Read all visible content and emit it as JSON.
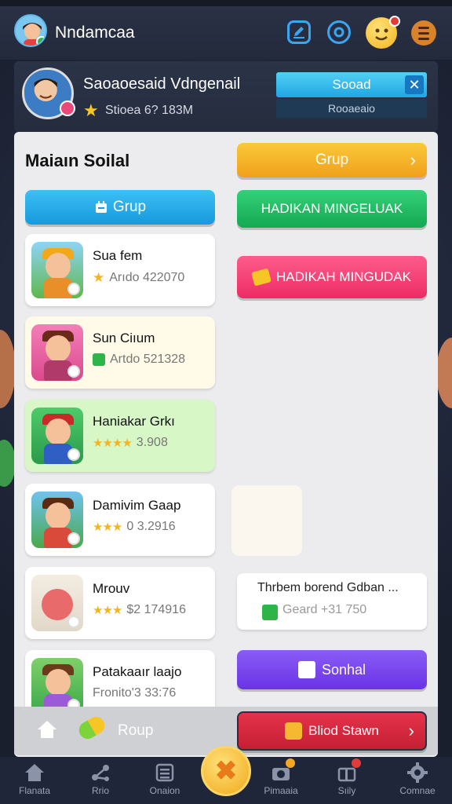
{
  "header": {
    "title": "Nndamcaa",
    "icons": [
      "edit-icon",
      "support-icon",
      "emoji-icon",
      "menu-icon"
    ]
  },
  "profile": {
    "name": "Saoaoesaid Vdngenail",
    "sub": "Stioea 6? 183M",
    "primary_button": "Sooad",
    "close": "✕",
    "secondary_button": "Rooaeaio"
  },
  "panel": {
    "title": "Maiaın Soilal",
    "btn_grup_top": "Gruр",
    "btn_grup_blue": "Grup",
    "btn_green": "HADIKAN MINGELUAK",
    "btn_pink": "HADIKAH MINGUDAK",
    "cards": [
      {
        "name": "Sua fem",
        "meta": "Arıdo 422070"
      },
      {
        "name": "Sun Ciıum",
        "meta": "Artdo 521328"
      },
      {
        "name": "Haniakar Grkı",
        "meta": "3.908"
      },
      {
        "name": "Damivim Gaap",
        "meta": "0 3.2916"
      },
      {
        "name": "Mrouv",
        "meta": "$2 174916"
      },
      {
        "name": "Patakaaır laajo",
        "meta": "Fronito'3 33:76"
      }
    ],
    "right_card": {
      "title": "Thrbem borend Gdban ...",
      "meta": "Geard +31 750"
    },
    "btn_purple": "Sonhal",
    "strip_label": "Roup",
    "btn_red": "Bliod Stawn"
  },
  "bottom_nav": [
    {
      "label": "Flanata",
      "icon": "home-icon"
    },
    {
      "label": "Rrio",
      "icon": "share-icon"
    },
    {
      "label": "Onaion",
      "icon": "list-icon"
    },
    {
      "label": "",
      "icon": "center-star-icon"
    },
    {
      "label": "Pimaaia",
      "icon": "camera-icon"
    },
    {
      "label": "Sıily",
      "icon": "gift-box-icon"
    },
    {
      "label": "Comnae",
      "icon": "gear-icon"
    }
  ],
  "colors": {
    "accent_blue": "#1fa6e3",
    "accent_yellow": "#f0a01b",
    "accent_green": "#14a852",
    "accent_pink": "#ec2c64",
    "accent_purple": "#6a33e6",
    "accent_red": "#c51f34"
  }
}
